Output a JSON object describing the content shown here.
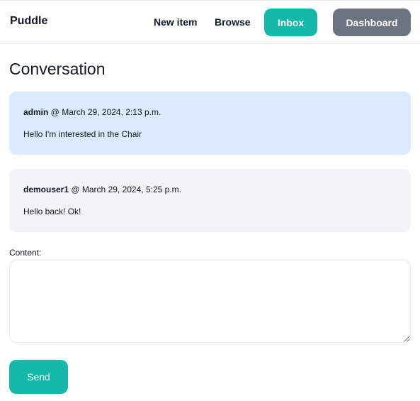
{
  "nav": {
    "brand": "Puddle",
    "new_item": "New item",
    "browse": "Browse",
    "inbox": "Inbox",
    "dashboard": "Dashboard"
  },
  "page": {
    "title": "Conversation"
  },
  "messages": [
    {
      "author": "admin",
      "separator": " @ ",
      "timestamp": "March 29, 2024, 2:13 p.m.",
      "body": "Hello I'm interested in the Chair"
    },
    {
      "author": "demouser1",
      "separator": " @ ",
      "timestamp": "March 29, 2024, 5:25 p.m.",
      "body": "Hello back! Ok!"
    }
  ],
  "form": {
    "content_label": "Content:",
    "content_value": "",
    "send_label": "Send"
  },
  "colors": {
    "accent": "#14b8a6",
    "secondary": "#6b7280",
    "message_own": "#dbeafe",
    "message_other": "#f3f4f6"
  }
}
